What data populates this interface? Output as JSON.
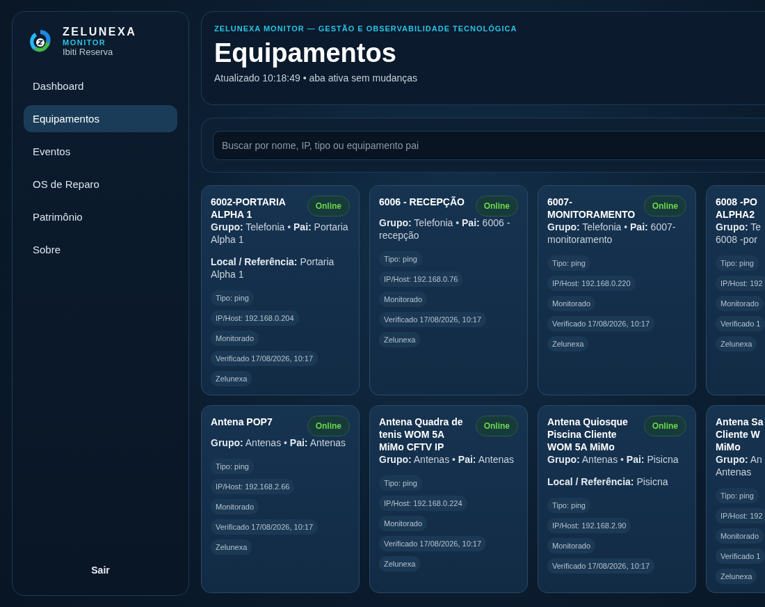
{
  "sidebar": {
    "brand": {
      "name": "ZELUNEXA",
      "product": "MONITOR",
      "site": "Ibiti Reserva"
    },
    "nav": [
      {
        "label": "Dashboard",
        "selected": false
      },
      {
        "label": "Equipamentos",
        "selected": true
      },
      {
        "label": "Eventos",
        "selected": false
      },
      {
        "label": "OS de Reparo",
        "selected": false
      },
      {
        "label": "Patrimônio",
        "selected": false
      },
      {
        "label": "Sobre",
        "selected": false
      }
    ],
    "logout": "Sair"
  },
  "header": {
    "eyebrow": "ZELUNEXA MONITOR — GESTÃO E OBSERVABILIDADE TECNOLÓGICA",
    "title": "Equipamentos",
    "subtitle": "Atualizado 10:18:49 • aba ativa sem mudanças"
  },
  "search": {
    "placeholder": "Buscar por nome, IP, tipo ou equipamento pai"
  },
  "cards": [
    {
      "title": "6002-PORTARIA ALPHA 1",
      "status": {
        "label": "Online",
        "kind": "online"
      },
      "meta": "**Grupo:** Telefonia  •  **Pai:** Portaria Alpha 1",
      "location": "**Local / Referência:** Portaria Alpha 1",
      "chips": [
        "Tipo: ping",
        "IP/Host: 192.168.0.204",
        "Monitorado",
        "Verificado 17/08/2026, 10:17",
        "Zelunexa"
      ]
    },
    {
      "title": "6006 - RECEPÇÃO",
      "status": {
        "label": "Online",
        "kind": "online"
      },
      "meta": "**Grupo:** Telefonia  •  **Pai:** 6006 -recepção",
      "chips": [
        "Tipo: ping",
        "IP/Host: 192.168.0.76",
        "Monitorado",
        "Verificado 17/08/2026, 10:17",
        "Zelunexa"
      ]
    },
    {
      "title": "6007-MONITORAMENTO",
      "status": {
        "label": "Online",
        "kind": "online"
      },
      "meta": "**Grupo:** Telefonia  •  **Pai:** 6007-monitoramento",
      "chips": [
        "Tipo: ping",
        "IP/Host: 192.168.0.220",
        "Monitorado",
        "Verificado 17/08/2026, 10:17",
        "Zelunexa"
      ]
    },
    {
      "title": "6008 -PO ALPHA2",
      "meta": "**Grupo:** Te 6008 -por",
      "chips": [
        "Tipo: ping",
        "IP/Host: 192",
        "Monitorado",
        "Verificado 1",
        "Zelunexa"
      ]
    },
    {
      "title": "Antena POP7",
      "status": {
        "label": "Online",
        "kind": "online"
      },
      "meta": "**Grupo:** Antenas  •  **Pai:** Antenas",
      "chips": [
        "Tipo: ping",
        "IP/Host: 192.168.2.66",
        "Monitorado",
        "Verificado 17/08/2026, 10:17",
        "Zelunexa"
      ]
    },
    {
      "title": "Antena Quadra de tenis WOM 5A MiMo CFTV IP",
      "status": {
        "label": "Online",
        "kind": "online"
      },
      "meta": "**Grupo:** Antenas  •  **Pai:** Antenas",
      "chips": [
        "Tipo: ping",
        "IP/Host: 192.168.0.224",
        "Monitorado",
        "Verificado 17/08/2026, 10:17",
        "Zelunexa"
      ]
    },
    {
      "title": "Antena Quiosque Piscina Cliente WOM 5A MiMo",
      "status": {
        "label": "Online",
        "kind": "online"
      },
      "meta": "**Grupo:** Antenas  •  **Pai:** Pisicna",
      "location": "**Local / Referência:** Pisicna",
      "chips": [
        "Tipo: ping",
        "IP/Host: 192.168.2.90",
        "Monitorado",
        "Verificado 17/08/2026, 10:17"
      ]
    },
    {
      "title": "Antena Sa Cliente W MiMo",
      "meta": "**Grupo:** An Antenas",
      "chips": [
        "Tipo: ping",
        "IP/Host: 192",
        "Monitorado",
        "Verificado 1",
        "Zelunexa"
      ]
    }
  ]
}
